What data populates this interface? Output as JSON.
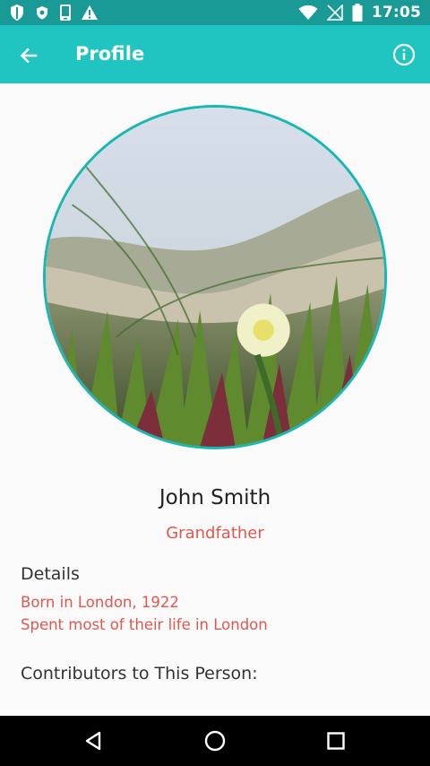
{
  "status_bar": {
    "time": "17:05",
    "icons": [
      "shield-icon",
      "vpn-key-icon",
      "phone-device-icon",
      "warning-icon",
      "wifi-icon",
      "no-signal-icon",
      "battery-icon"
    ]
  },
  "app_bar": {
    "title": "Profile",
    "back_icon": "arrow-back-icon",
    "info_icon": "info-icon"
  },
  "profile": {
    "name": "John Smith",
    "relation": "Grandfather",
    "photo": "circular photo of an ice plant flower on sandy dunes"
  },
  "details": {
    "heading": "Details",
    "lines": [
      "Born in London, 1922",
      "Spent most of their life in London"
    ]
  },
  "contributors": {
    "heading": "Contributors to This Person:"
  },
  "nav_bar": {
    "icons": [
      "nav-back-icon",
      "nav-home-icon",
      "nav-recent-icon"
    ]
  },
  "colors": {
    "status_bar": "#1a9a97",
    "app_bar": "#20c4c0",
    "accent_text": "#e0574f",
    "avatar_border": "#19b7b3"
  }
}
